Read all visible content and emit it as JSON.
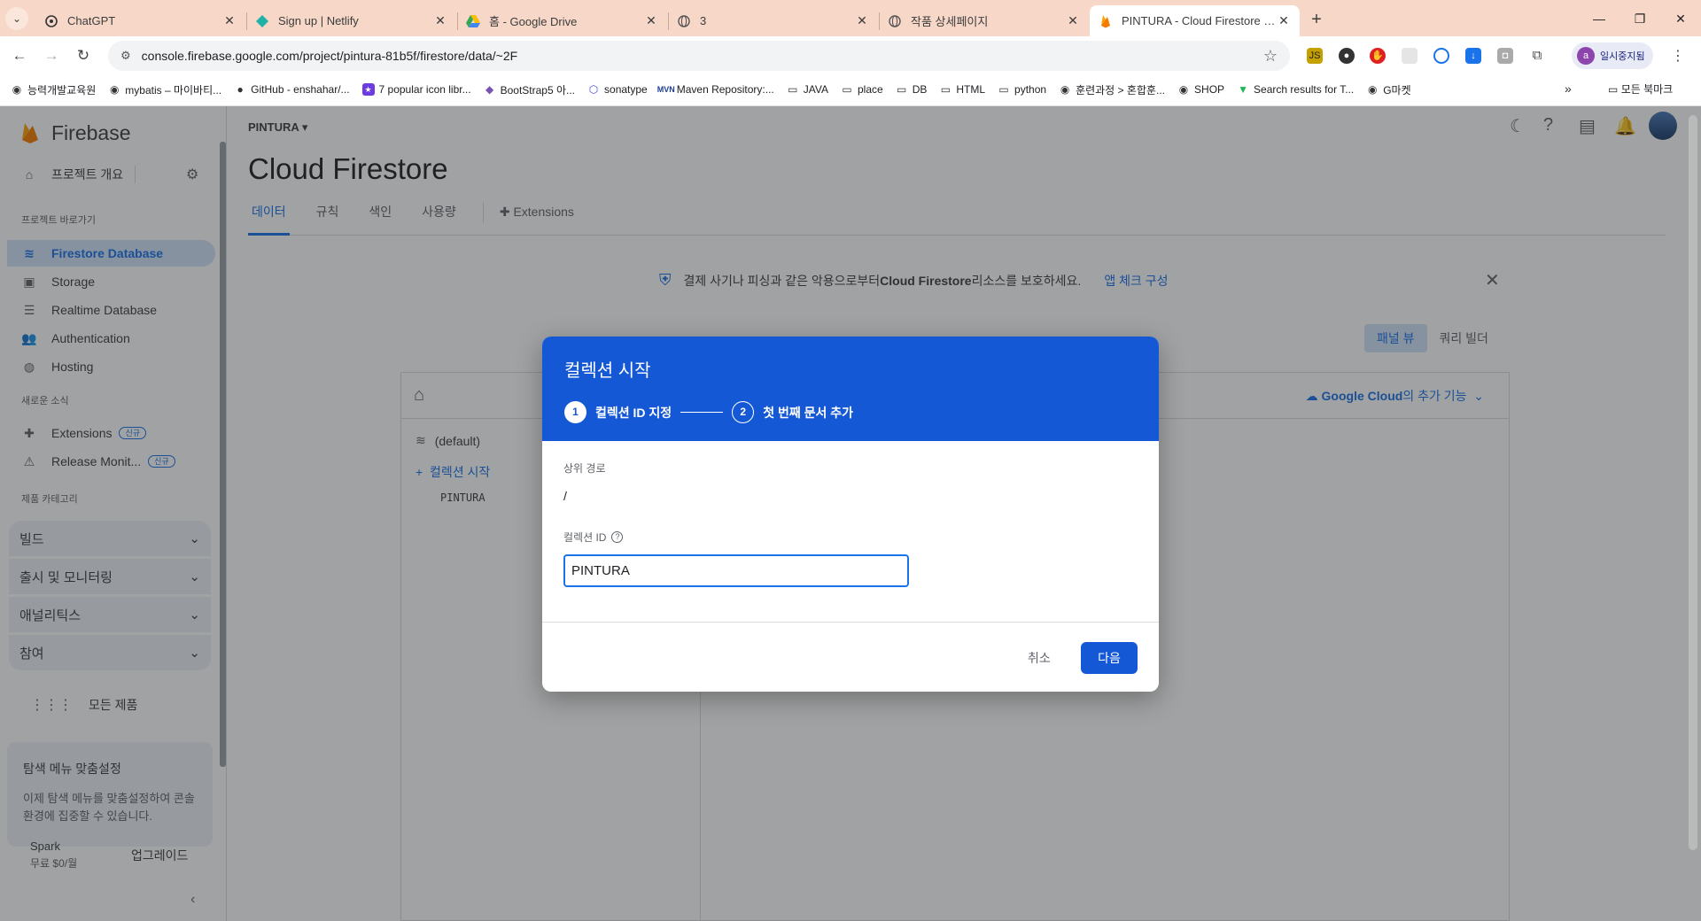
{
  "browser": {
    "tabs": [
      {
        "title": "ChatGPT",
        "icon": "chatgpt-icon"
      },
      {
        "title": "Sign up | Netlify",
        "icon": "netlify-icon"
      },
      {
        "title": "홈 - Google Drive",
        "icon": "google-drive-icon"
      },
      {
        "title": "3",
        "icon": "globe-icon"
      },
      {
        "title": "작품 상세페이지",
        "icon": "globe-icon"
      },
      {
        "title": "PINTURA - Cloud Firestore - Firebase",
        "icon": "firebase-icon"
      }
    ],
    "url": "console.firebase.google.com/project/pintura-81b5f/firestore/data/~2F",
    "profile_label": "일시중지됨",
    "profile_initial": "a",
    "bookmarks": [
      "능력개발교육원",
      "mybatis – 마이바티...",
      "GitHub - enshahar/...",
      "7 popular icon libr...",
      "BootStrap5 아...",
      "sonatype",
      "Maven Repository:...",
      "JAVA",
      "place",
      "DB",
      "HTML",
      "python",
      "훈련과정 > 혼합훈...",
      "SHOP",
      "Search results for T...",
      "G마켓"
    ],
    "all_bookmarks": "모든 북마크"
  },
  "sidebar": {
    "brand": "Firebase",
    "overview": "프로젝트 개요",
    "shortcuts_heading": "프로젝트 바로가기",
    "shortcuts": [
      "Firestore Database",
      "Storage",
      "Realtime Database",
      "Authentication",
      "Hosting"
    ],
    "news_heading": "새로운 소식",
    "news": [
      {
        "label": "Extensions",
        "badge": "신규"
      },
      {
        "label": "Release Monit...",
        "badge": "신규"
      }
    ],
    "categories_heading": "제품 카테고리",
    "categories": [
      "빌드",
      "출시 및 모니터링",
      "애널리틱스",
      "참여"
    ],
    "all_products": "모든 제품",
    "promo_title": "탐색 메뉴 맞춤설정",
    "promo_body": "이제 탐색 메뉴를 맞춤설정하여 콘솔 환경에 집중할 수 있습니다.",
    "plan_name": "Spark",
    "plan_price": "무료 $0/월",
    "upgrade": "업그레이드"
  },
  "main": {
    "project": "PINTURA",
    "title": "Cloud Firestore",
    "tabs": [
      "데이터",
      "규칙",
      "색인",
      "사용량",
      "Extensions"
    ],
    "banner_pre": "결제 사기나 피싱과 같은 악용으로부터 ",
    "banner_bold": "Cloud Firestore",
    "banner_post": " 리소스를 보호하세요.",
    "banner_link": "앱 체크 구성",
    "view_panel": "패널 뷰",
    "view_query": "쿼리 빌더",
    "gc_bold": "Google Cloud",
    "gc_rest": "의 추가 기능",
    "database": "(default)",
    "start_collection": "컬렉션 시작",
    "collection": "PINTURA"
  },
  "dialog": {
    "title": "컬렉션 시작",
    "step1_num": "1",
    "step1_label": "컬렉션 ID 지정",
    "step2_num": "2",
    "step2_label": "첫 번째 문서 추가",
    "parent_path_label": "상위 경로",
    "parent_path_value": "/",
    "collection_id_label": "컬렉션 ID",
    "collection_id_value": "PINTURA",
    "cancel": "취소",
    "next": "다음"
  }
}
